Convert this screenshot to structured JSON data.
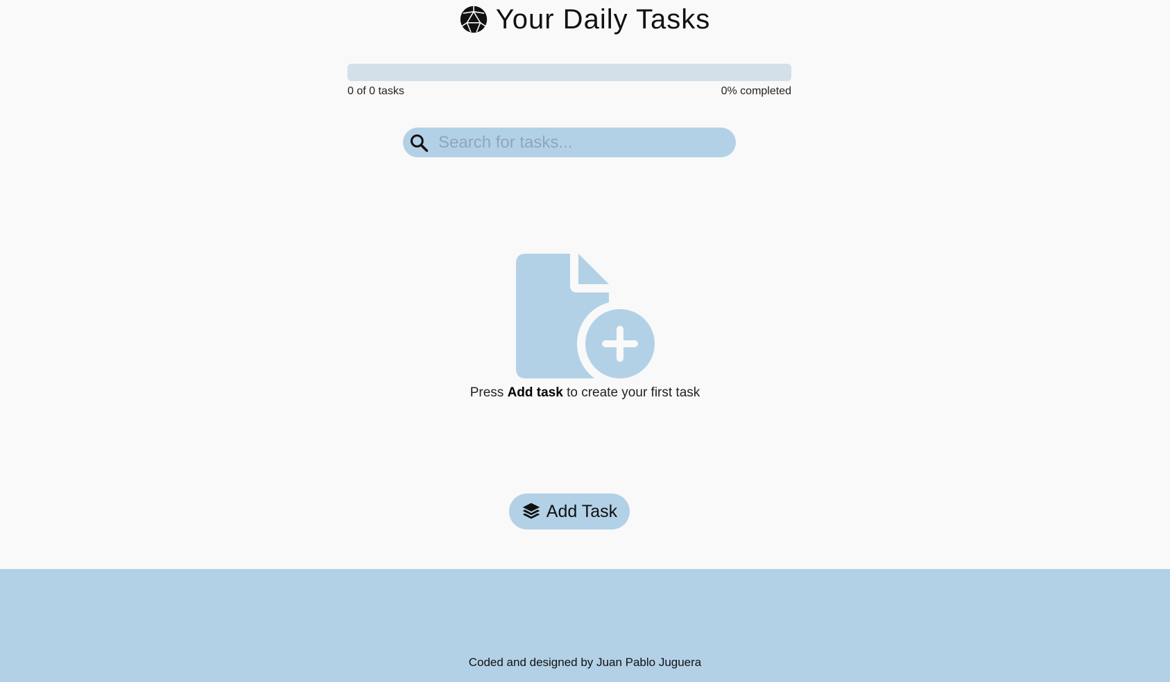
{
  "header": {
    "title": "Your Daily Tasks",
    "logo_icon": "dice-icon"
  },
  "progress": {
    "completed_count": 0,
    "total_count": 0,
    "percent": 0,
    "count_label": "0 of 0 tasks",
    "percent_label": "0% completed"
  },
  "search": {
    "placeholder": "Search for tasks...",
    "value": "",
    "icon": "search-icon"
  },
  "empty_state": {
    "icon": "file-plus-icon",
    "text_before": "Press",
    "text_bold": "Add task",
    "text_after": "to create your first task"
  },
  "actions": {
    "add_task_label": "Add Task",
    "add_task_icon": "layers-icon"
  },
  "footer": {
    "credit": "Coded and designed by Juan Pablo Juguera"
  },
  "colors": {
    "background": "#f9f9f9",
    "accent": "#b3d1e6",
    "progress_track": "#d3dfe9",
    "text": "#111111"
  }
}
